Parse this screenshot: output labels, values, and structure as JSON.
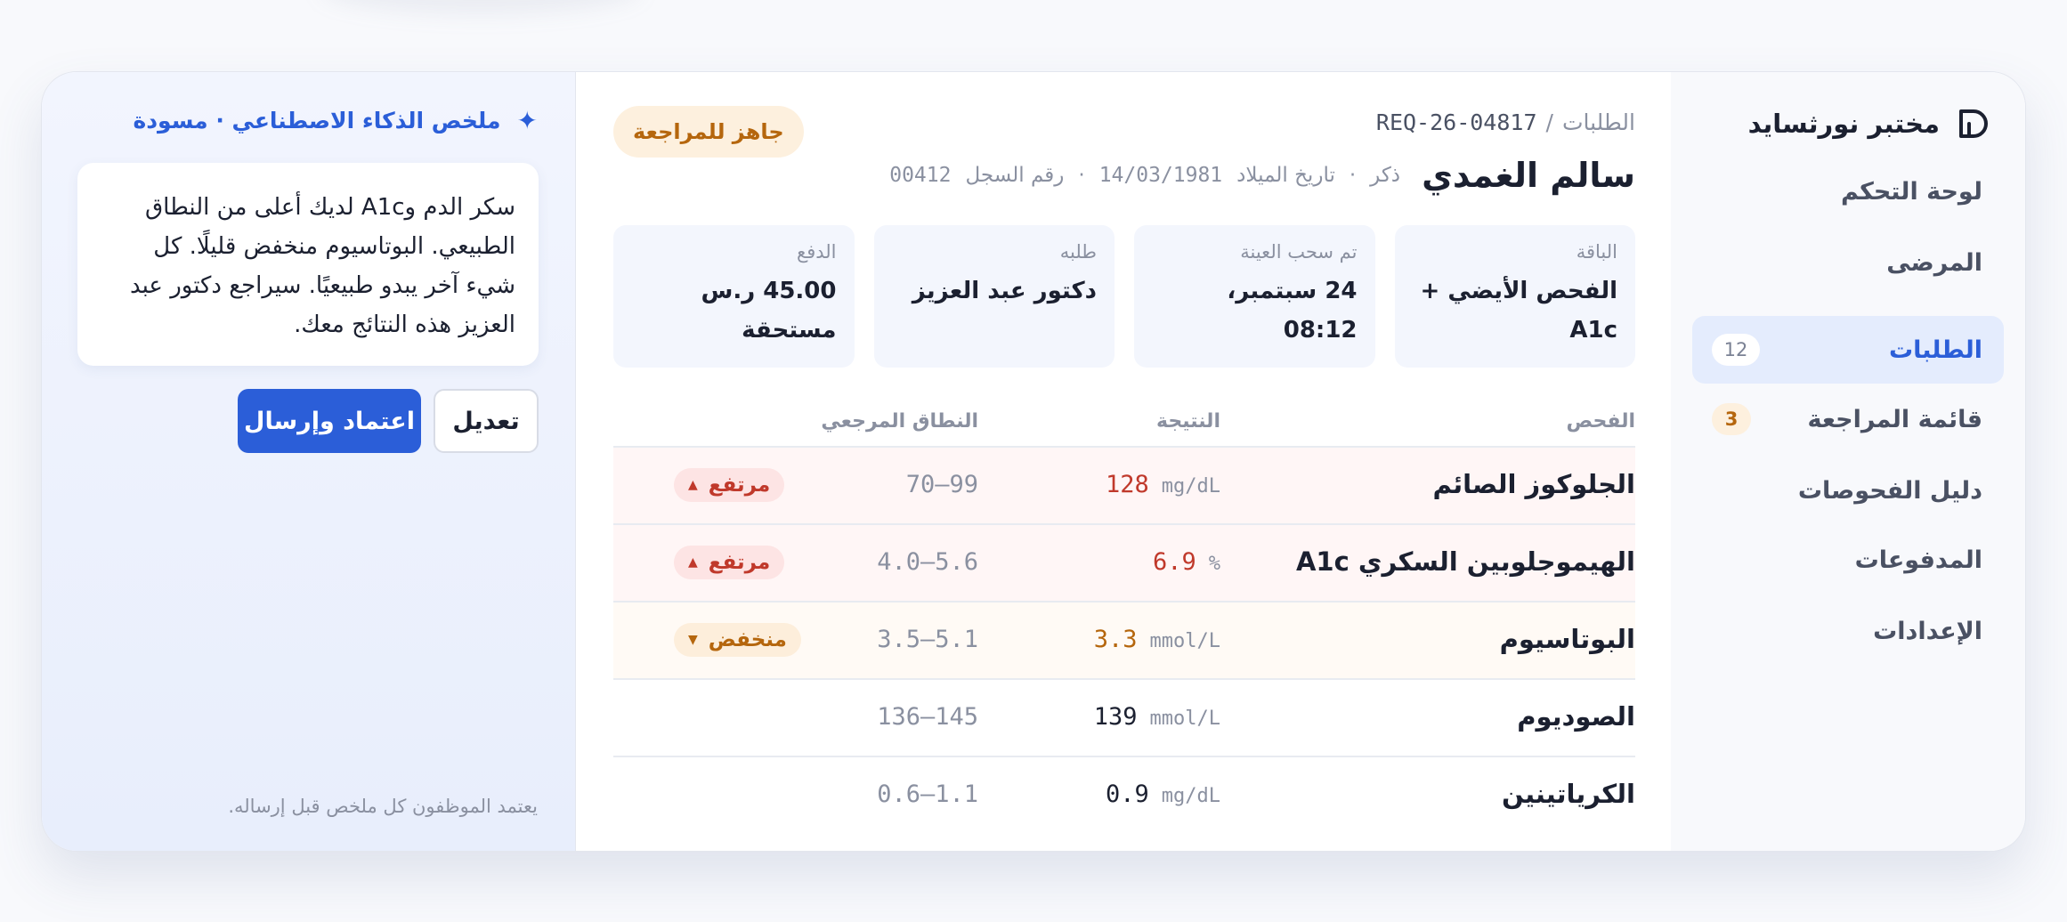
{
  "app": {
    "name": "مختبر نورثسايد"
  },
  "sidebar": {
    "items": [
      {
        "label": "لوحة التحكم",
        "badge": ""
      },
      {
        "label": "المرضى",
        "badge": ""
      },
      {
        "label": "الطلبات",
        "badge": "12",
        "active": true
      },
      {
        "label": "قائمة المراجعة",
        "badge": "3"
      },
      {
        "label": "دليل الفحوصات",
        "badge": ""
      },
      {
        "label": "المدفوعات",
        "badge": ""
      },
      {
        "label": "الإعدادات",
        "badge": ""
      }
    ]
  },
  "breadcrumb": {
    "parent": "الطلبات",
    "separator": "/",
    "current": "REQ-26-04817"
  },
  "status_badge": "جاهز للمراجعة",
  "patient": {
    "name": "سالم الغمدي",
    "sex": "ذكر",
    "dob_label": "تاريخ الميلاد",
    "dob": "14/03/1981",
    "record_label": "رقم السجل",
    "record": "00412",
    "dot": "·"
  },
  "info_cards": [
    {
      "label": "الباقة",
      "value": "الفحص الأيضي + A1c"
    },
    {
      "label": "تم سحب العينة",
      "value": "24 سبتمبر، 08:12"
    },
    {
      "label": "طلبه",
      "value": "دكتور عبد العزيز"
    },
    {
      "label": "الدفع",
      "value": "45.00 ر.س مستحقة"
    }
  ],
  "table": {
    "headers": {
      "test": "الفحص",
      "result": "النتيجة",
      "range": "النطاق المرجعي"
    },
    "rows": [
      {
        "test": "الجلوكوز الصائم",
        "value": "128",
        "unit": "mg/dL",
        "range": "70–99",
        "flag": "مرتفع",
        "flag_type": "high"
      },
      {
        "test": "الهيموجلوبين السكري A1c",
        "value": "6.9",
        "unit": "%",
        "range": "4.0–5.6",
        "flag": "مرتفع",
        "flag_type": "high"
      },
      {
        "test": "البوتاسيوم",
        "value": "3.3",
        "unit": "mmol/L",
        "range": "3.5–5.1",
        "flag": "منخفض",
        "flag_type": "low"
      },
      {
        "test": "الصوديوم",
        "value": "139",
        "unit": "mmol/L",
        "range": "136–145",
        "flag": "",
        "flag_type": ""
      },
      {
        "test": "الكرياتينين",
        "value": "0.9",
        "unit": "mg/dL",
        "range": "0.6–1.1",
        "flag": "",
        "flag_type": ""
      }
    ]
  },
  "ai": {
    "title": "ملخص الذكاء الاصطناعي · مسودة",
    "summary": "سكر الدم وA1c لديك أعلى من النطاق الطبيعي. البوتاسيوم منخفض قليلًا. كل شيء آخر يبدو طبيعيًا. سيراجع دكتور عبد العزيز هذه النتائج معك.",
    "edit_label": "تعديل",
    "approve_label": "اعتماد وإرسال",
    "footer": "يعتمد الموظفون كل ملخص قبل إرساله."
  },
  "colors": {
    "accent": "#2b5ed8",
    "high": "#c0392b",
    "low": "#b5660d"
  }
}
